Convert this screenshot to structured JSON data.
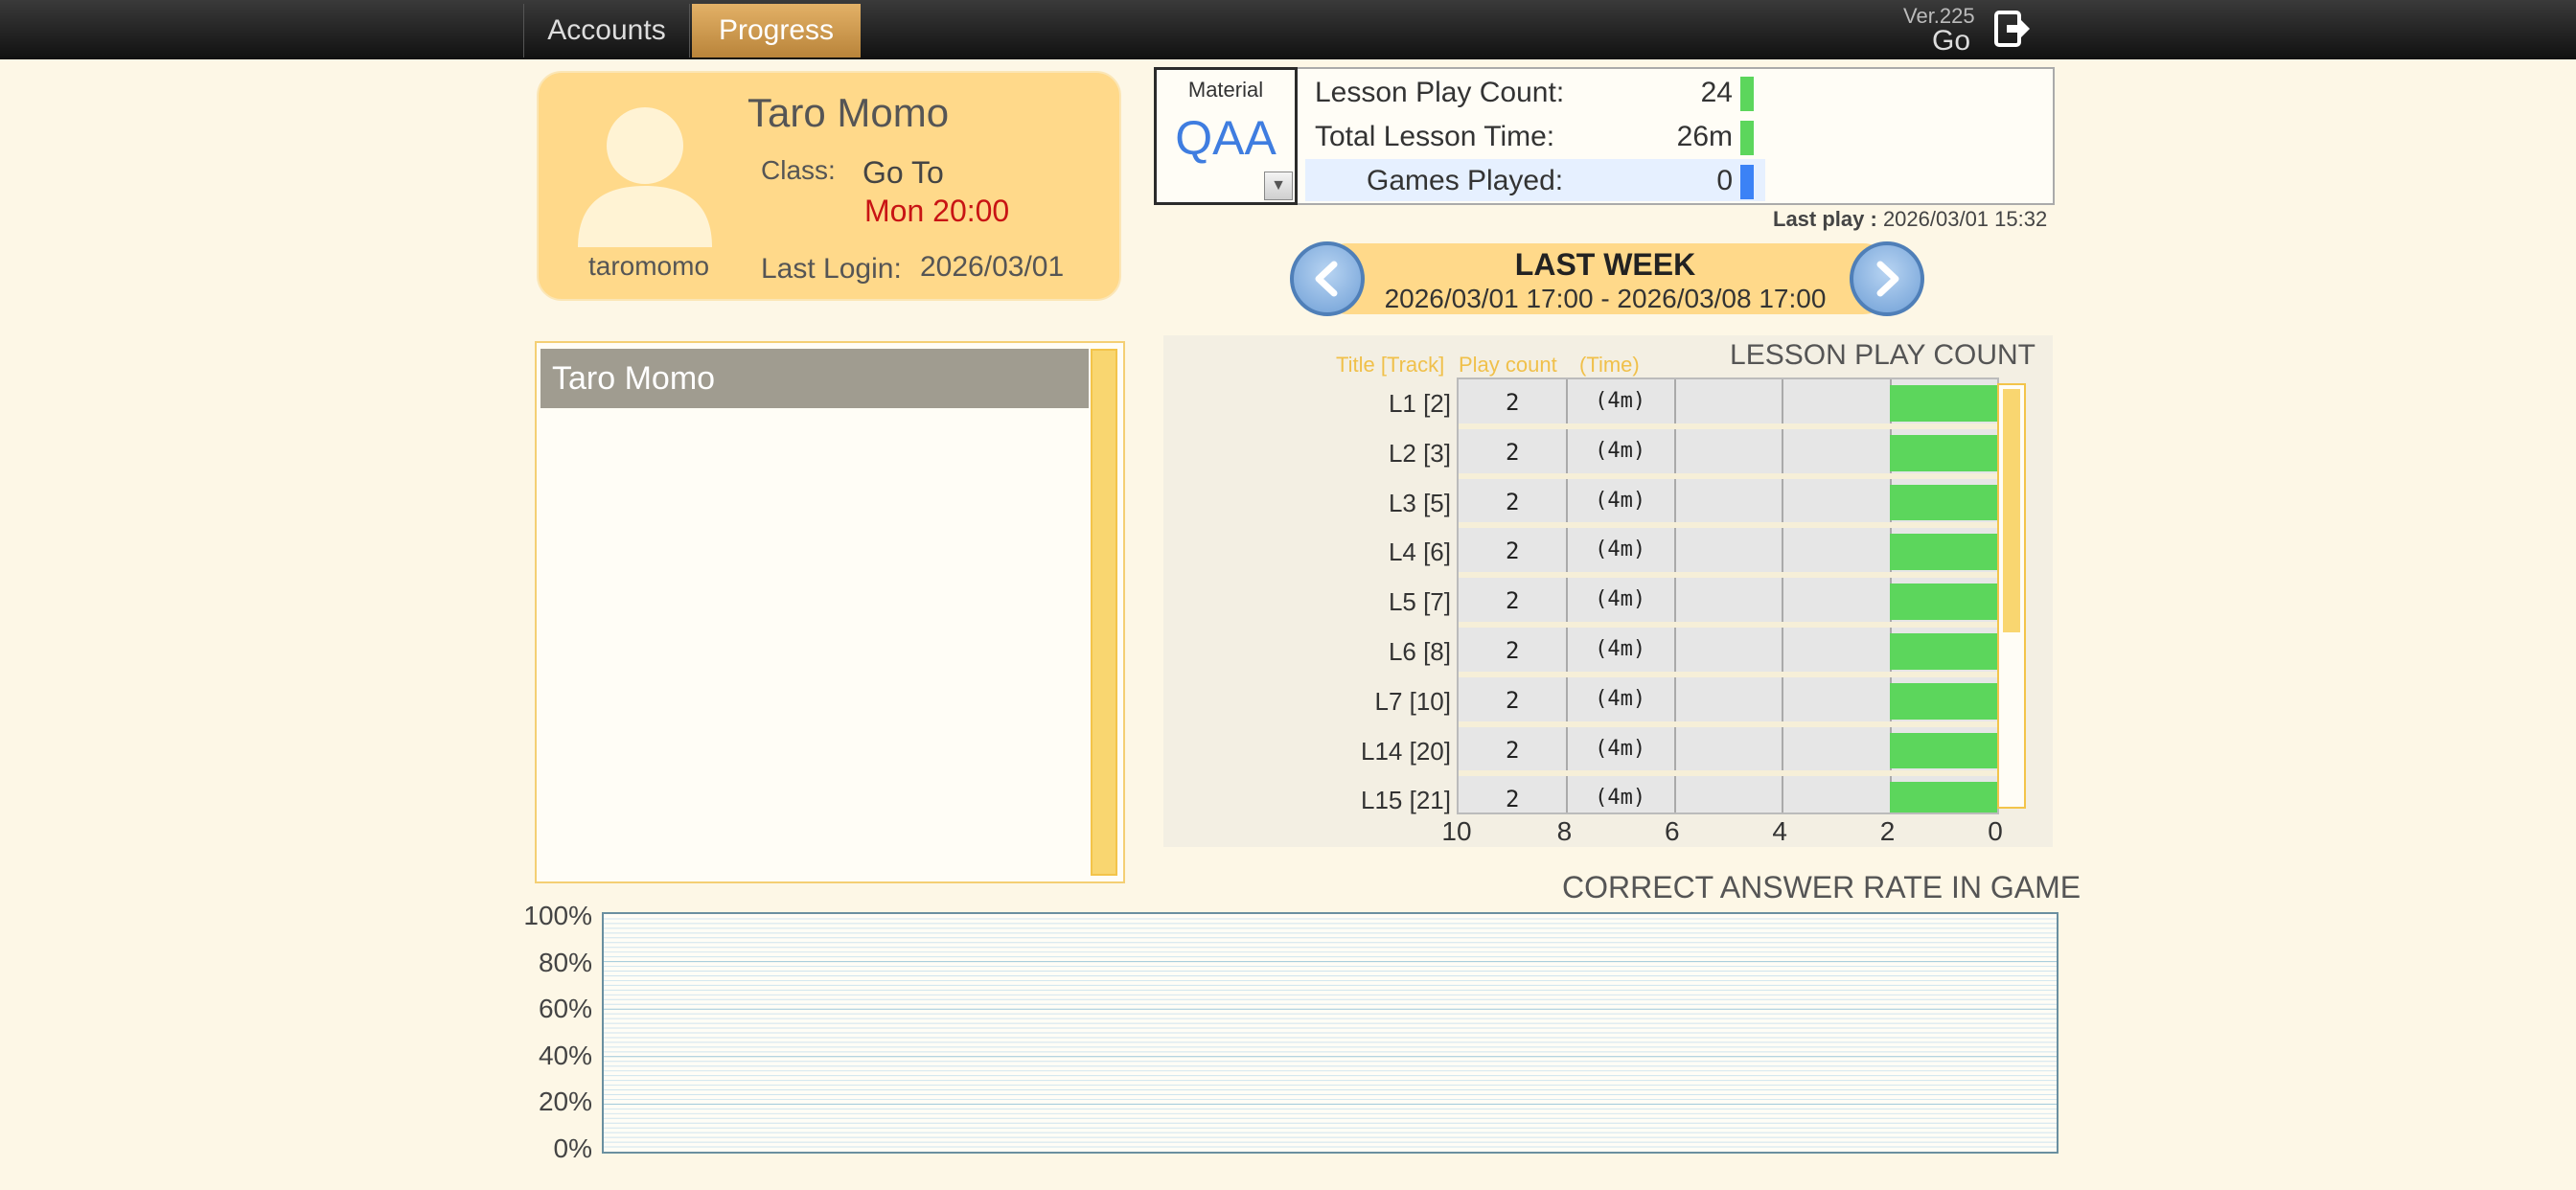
{
  "header": {
    "tabs": [
      {
        "label": "Accounts",
        "active": false
      },
      {
        "label": "Progress",
        "active": true
      }
    ],
    "version": "Ver.225",
    "go_label": "Go",
    "logout_icon": "logout-icon"
  },
  "profile": {
    "name": "Taro Momo",
    "username": "taromomo",
    "class_label": "Class:",
    "class_value": "Go To",
    "class_time": "Mon 20:00",
    "last_login_label": "Last Login:",
    "last_login_value": "2026/03/01"
  },
  "material": {
    "label": "Material",
    "value": "QAA"
  },
  "stats": {
    "lesson_play_count_label": "Lesson Play Count:",
    "lesson_play_count_value": "24",
    "total_lesson_time_label": "Total Lesson Time:",
    "total_lesson_time_value": "26m",
    "games_played_label": "Games Played:",
    "games_played_value": "0",
    "colors": {
      "green": "#5cd65c",
      "blue": "#3b82f6"
    }
  },
  "last_play": {
    "label": "Last play :",
    "value": "2026/03/01 15:32"
  },
  "week": {
    "title": "LAST WEEK",
    "range": "2026/03/01 17:00 - 2026/03/08 17:00"
  },
  "student_list": {
    "items": [
      "Taro Momo"
    ]
  },
  "lesson_chart": {
    "title": "LESSON PLAY COUNT",
    "col_title": "Title [Track]",
    "col_count": "Play count",
    "col_time": "(Time)"
  },
  "answer_chart": {
    "title": "CORRECT ANSWER RATE IN GAME"
  },
  "chart_data": [
    {
      "type": "bar",
      "orientation": "horizontal",
      "title": "LESSON PLAY COUNT",
      "categories": [
        "L1 [2]",
        "L2 [3]",
        "L3 [5]",
        "L4 [6]",
        "L5 [7]",
        "L6 [8]",
        "L7 [10]",
        "L14 [20]",
        "L15 [21]"
      ],
      "values": [
        2,
        2,
        2,
        2,
        2,
        2,
        2,
        2,
        2
      ],
      "times": [
        "(4m)",
        "(4m)",
        "(4m)",
        "(4m)",
        "(4m)",
        "(4m)",
        "(4m)",
        "(4m)",
        "(4m)"
      ],
      "xlim": [
        10,
        0
      ],
      "xticks": [
        "10",
        "8",
        "6",
        "4",
        "2",
        "0"
      ],
      "bar_color": "#5cd65c"
    },
    {
      "type": "line",
      "title": "CORRECT ANSWER RATE IN GAME",
      "series": [],
      "ylim": [
        0,
        100
      ],
      "yticks": [
        "100%",
        "80%",
        "60%",
        "40%",
        "20%",
        "0%"
      ],
      "grid": true
    }
  ]
}
